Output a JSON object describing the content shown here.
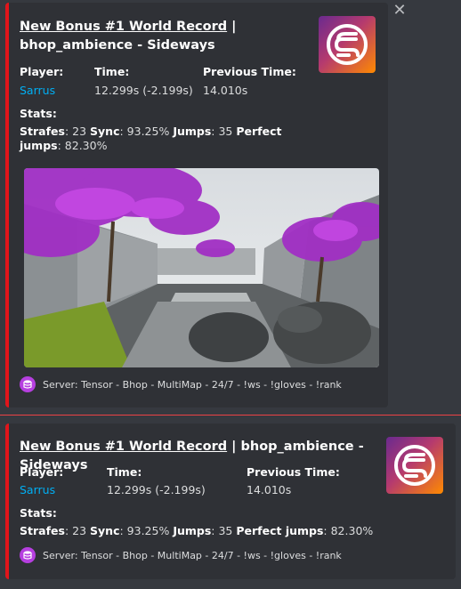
{
  "close_icon": "close-icon",
  "accent_color": "#e0151b",
  "link_color": "#00aff4",
  "embeds": [
    {
      "title_link": "New Bonus #1 World Record",
      "title_rest": " | bhop_ambience - Sideways",
      "fields": {
        "player_label": "Player:",
        "player_value": "Sarrus",
        "time_label": "Time:",
        "time_value": "12.299s (-2.199s)",
        "prev_label": "Previous Time:",
        "prev_value": "14.010s"
      },
      "stats_label": "Stats:",
      "stats": {
        "strafes_label": "Strafes",
        "strafes_value": ": 23 ",
        "sync_label": "Sync",
        "sync_value": ": 93.25% ",
        "jumps_label": "Jumps",
        "jumps_value": ": 35 ",
        "perfect_label": "Perfect jumps",
        "perfect_value": ": 82.30%"
      },
      "footer": "Server: Tensor - Bhop - MultiMap - 24/7 - !ws - !gloves - !rank"
    },
    {
      "title_link": "New Bonus #1 World Record",
      "title_rest": " | bhop_ambience - Sideways",
      "fields": {
        "player_label": "Player:",
        "player_value": "Sarrus",
        "time_label": "Time:",
        "time_value": "12.299s (-2.199s)",
        "prev_label": "Previous Time:",
        "prev_value": "14.010s"
      },
      "stats_label": "Stats:",
      "stats": {
        "strafes_label": "Strafes",
        "strafes_value": ": 23 ",
        "sync_label": "Sync",
        "sync_value": ": 93.25% ",
        "jumps_label": "Jumps",
        "jumps_value": ": 35 ",
        "perfect_label": "Perfect jumps",
        "perfect_value": ": 82.30%"
      },
      "footer": "Server: Tensor - Bhop - MultiMap - 24/7 - !ws - !gloves - !rank"
    }
  ]
}
